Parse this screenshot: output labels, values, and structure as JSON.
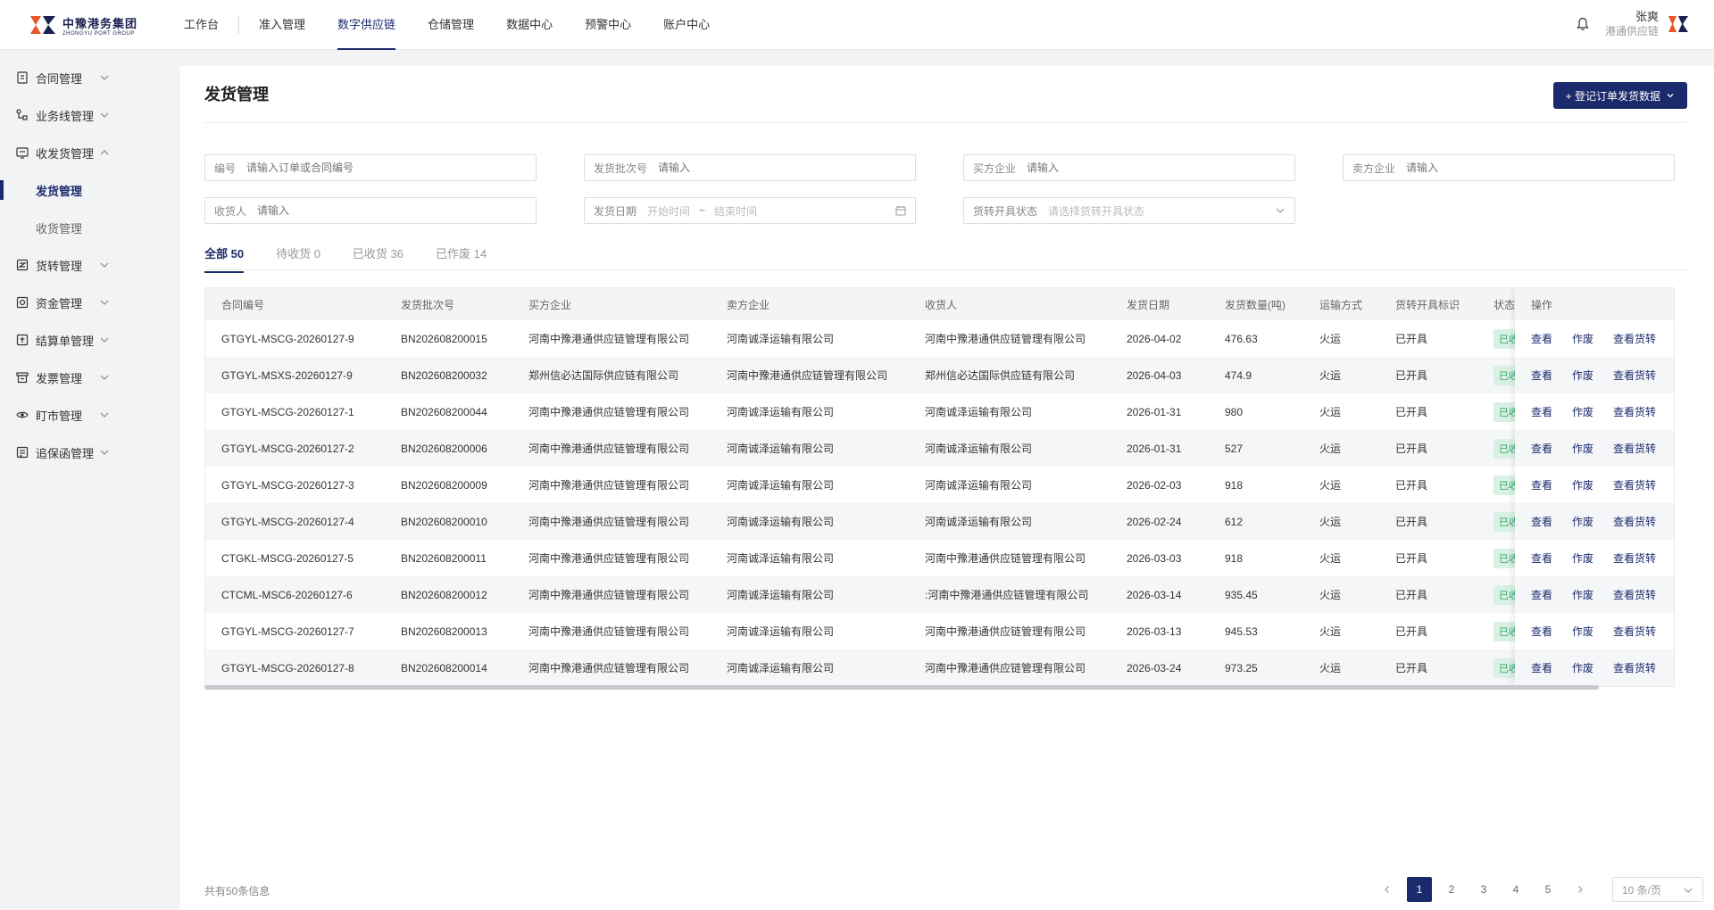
{
  "header": {
    "logo_cn": "中豫港务集团",
    "logo_en": "ZHONGYU PORT GROUP",
    "nav": [
      {
        "label": "工作台"
      },
      {
        "label": "准入管理"
      },
      {
        "label": "数字供应链"
      },
      {
        "label": "仓储管理"
      },
      {
        "label": "数据中心"
      },
      {
        "label": "预警中心"
      },
      {
        "label": "账户中心"
      }
    ],
    "active_nav": "数字供应链",
    "user_name": "张爽",
    "user_org": "港通供应链"
  },
  "sidebar": {
    "items": [
      {
        "label": "合同管理",
        "icon": "contract-icon"
      },
      {
        "label": "业务线管理",
        "icon": "business-line-icon"
      },
      {
        "label": "收发货管理",
        "icon": "shipping-icon",
        "expanded": true
      },
      {
        "label": "货转管理",
        "icon": "transfer-icon"
      },
      {
        "label": "资金管理",
        "icon": "fund-icon"
      },
      {
        "label": "结算单管理",
        "icon": "settlement-icon"
      },
      {
        "label": "发票管理",
        "icon": "invoice-icon"
      },
      {
        "label": "盯市管理",
        "icon": "eye-icon"
      },
      {
        "label": "追保函管理",
        "icon": "guarantee-icon"
      }
    ],
    "sub_items": [
      {
        "label": "发货管理",
        "active": true
      },
      {
        "label": "收货管理"
      }
    ]
  },
  "page": {
    "title": "发货管理",
    "primary_button": "+ 登记订单发货数据"
  },
  "filters": {
    "code": {
      "label": "编号",
      "placeholder": "请输入订单或合同编号"
    },
    "batch": {
      "label": "发货批次号",
      "placeholder": "请输入"
    },
    "buyer": {
      "label": "买方企业",
      "placeholder": "请输入"
    },
    "seller": {
      "label": "卖方企业",
      "placeholder": "请输入"
    },
    "receiver": {
      "label": "收货人",
      "placeholder": "请输入"
    },
    "date": {
      "label": "发货日期",
      "start": "开始时间",
      "sep": "~",
      "end": "结束时间"
    },
    "status": {
      "label": "货转开具状态",
      "placeholder": "请选择货转开具状态"
    }
  },
  "tabs": [
    {
      "label": "全部 50",
      "active": true
    },
    {
      "label": "待收货 0"
    },
    {
      "label": "已收货 36"
    },
    {
      "label": "已作废 14"
    }
  ],
  "table": {
    "columns": [
      "合同编号",
      "发货批次号",
      "买方企业",
      "卖方企业",
      "收货人",
      "发货日期",
      "发货数量(吨)",
      "运输方式",
      "货转开具标识",
      "状态"
    ],
    "ops_header": "操作",
    "ops": [
      "查看",
      "作废",
      "查看货转"
    ],
    "rows": [
      [
        "GTGYL-MSCG-20260127-9",
        "BN202608200015",
        "河南中豫港通供应链管理有限公司",
        "河南诚泽运输有限公司",
        "河南中豫港通供应链管理有限公司",
        "2026-04-02",
        "476.63",
        "火运",
        "已开具",
        "已收货"
      ],
      [
        "GTGYL-MSXS-20260127-9",
        "BN202608200032",
        "郑州信必达国际供应链有限公司",
        "河南中豫港通供应链管理有限公司",
        "郑州信必达国际供应链有限公司",
        "2026-04-03",
        "474.9",
        "火运",
        "已开具",
        "已收货"
      ],
      [
        "GTGYL-MSCG-20260127-1",
        "BN202608200044",
        "河南中豫港通供应链管理有限公司",
        "河南诚泽运输有限公司",
        "河南诚泽运输有限公司",
        "2026-01-31",
        "980",
        "火运",
        "已开具",
        "已收货"
      ],
      [
        "GTGYL-MSCG-20260127-2",
        "BN202608200006",
        "河南中豫港通供应链管理有限公司",
        "河南诚泽运输有限公司",
        "河南诚泽运输有限公司",
        "2026-01-31",
        "527",
        "火运",
        "已开具",
        "已收货"
      ],
      [
        "GTGYL-MSCG-20260127-3",
        "BN202608200009",
        "河南中豫港通供应链管理有限公司",
        "河南诚泽运输有限公司",
        "河南诚泽运输有限公司",
        "2026-02-03",
        "918",
        "火运",
        "已开具",
        "已收货"
      ],
      [
        "GTGYL-MSCG-20260127-4",
        "BN202608200010",
        "河南中豫港通供应链管理有限公司",
        "河南诚泽运输有限公司",
        "河南诚泽运输有限公司",
        "2026-02-24",
        "612",
        "火运",
        "已开具",
        "已收货"
      ],
      [
        "CTGKL-MSCG-20260127-5",
        "BN202608200011",
        "河南中豫港通供应链管理有限公司",
        "河南诚泽运输有限公司",
        "河南中豫港通供应链管理有限公司",
        "2026-03-03",
        "918",
        "火运",
        "已开具",
        "已收货"
      ],
      [
        "CTCML-MSC6-20260127-6",
        "BN202608200012",
        "河南中豫港通供应链管理有限公司",
        "河南诚泽运输有限公司",
        ":河南中豫港通供应链管理有限公司",
        "2026-03-14",
        "935.45",
        "火运",
        "已开具",
        "已收货"
      ],
      [
        "GTGYL-MSCG-20260127-7",
        "BN202608200013",
        "河南中豫港通供应链管理有限公司",
        "河南诚泽运输有限公司",
        "河南中豫港通供应链管理有限公司",
        "2026-03-13",
        "945.53",
        "火运",
        "已开具",
        "已收货"
      ],
      [
        "GTGYL-MSCG-20260127-8",
        "BN202608200014",
        "河南中豫港通供应链管理有限公司",
        "河南诚泽运输有限公司",
        "河南中豫港通供应链管理有限公司",
        "2026-03-24",
        "973.25",
        "火运",
        "已开具",
        "已收货"
      ]
    ]
  },
  "footer": {
    "total": "共有50条信息",
    "pages": [
      "1",
      "2",
      "3",
      "4",
      "5"
    ],
    "page_size": "10 条/页"
  },
  "colors": {
    "primary": "#1b2a6b",
    "badge_bg": "#d8f1e4",
    "badge_text": "#33a466"
  }
}
